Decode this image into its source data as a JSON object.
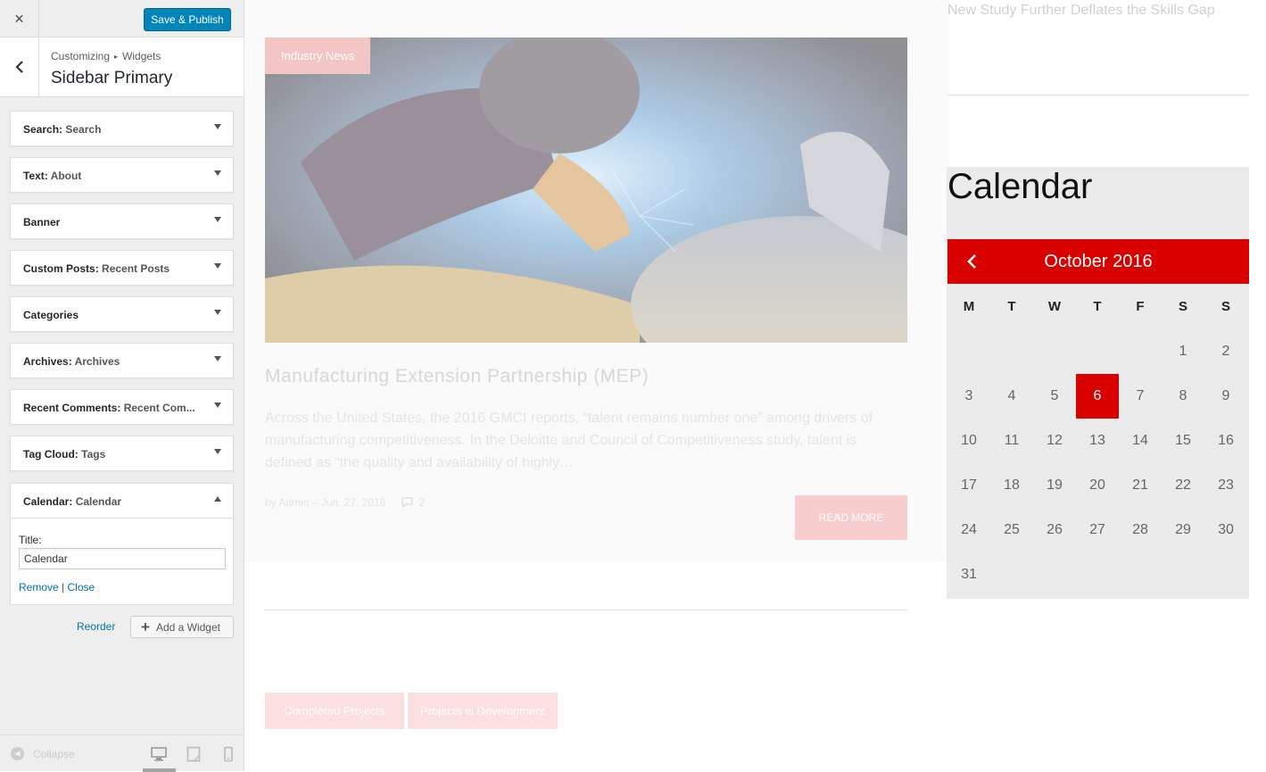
{
  "customizer": {
    "close_icon": "×",
    "save_label": "Save & Publish",
    "breadcrumb": [
      "Customizing",
      "Widgets"
    ],
    "section_title": "Sidebar Primary",
    "widgets": [
      {
        "type": "Search",
        "instance": "Search"
      },
      {
        "type": "Text",
        "instance": "About"
      },
      {
        "type": "Banner",
        "instance": ""
      },
      {
        "type": "Custom Posts",
        "instance": "Recent Posts"
      },
      {
        "type": "Categories",
        "instance": ""
      },
      {
        "type": "Archives",
        "instance": "Archives"
      },
      {
        "type": "Recent Comments",
        "instance": "Recent Com..."
      },
      {
        "type": "Tag Cloud",
        "instance": "Tags"
      },
      {
        "type": "Calendar",
        "instance": "Calendar"
      }
    ],
    "calendar_form": {
      "title_label": "Title:",
      "title_value": "Calendar",
      "remove_label": "Remove",
      "separator": "|",
      "close_label": "Close"
    },
    "reorder_label": "Reorder",
    "add_widget_label": "Add a Widget",
    "collapse_label": "Collapse",
    "devices": [
      "desktop-icon",
      "tablet-icon",
      "mobile-icon"
    ],
    "accent_color": "#0085ba"
  },
  "preview": {
    "post": {
      "category": "Industry News",
      "title": "Manufacturing Extension Partnership (MEP)",
      "excerpt": "Across the United States, the 2016 GMCI reports, “talent remains number one” among drivers of manufacturing competitiveness. In the Deloitte and Council of Competitiveness study, talent is defined as “the quality and availability of highly…",
      "meta": "by Admin – Jun. 27, 2016",
      "comments": "2",
      "read_more": "READ MORE"
    },
    "project_buttons": [
      "Completed Projects",
      "Projects is Development"
    ],
    "recent_post_link": "New Study Further Deflates the Skills Gap",
    "calendar": {
      "heading": "Calendar",
      "month": "October 2016",
      "day_heads": [
        "M",
        "T",
        "W",
        "T",
        "F",
        "S",
        "S"
      ],
      "first_weekday_index": 5,
      "days_in_month": 31,
      "today": 6,
      "accent_color": "#d90000"
    }
  }
}
